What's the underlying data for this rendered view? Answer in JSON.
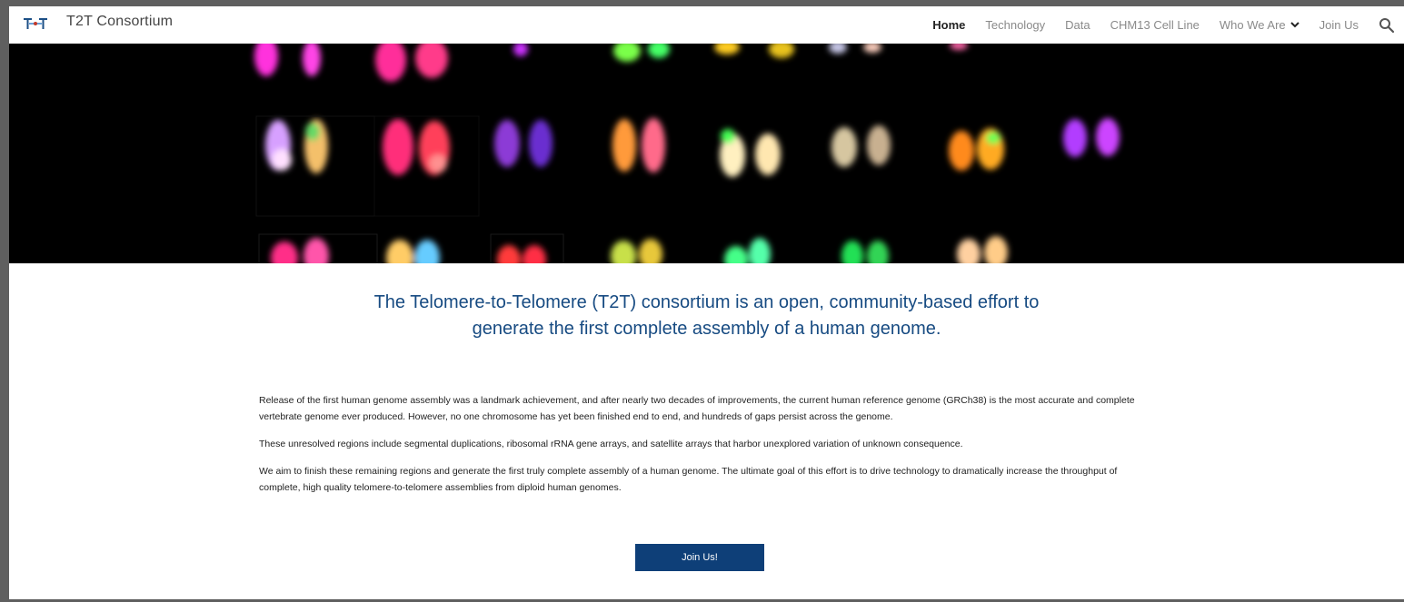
{
  "header": {
    "site_title": "T2T Consortium",
    "logo_icon": "t2t-logo-icon",
    "nav": [
      {
        "label": "Home",
        "active": true
      },
      {
        "label": "Technology",
        "active": false
      },
      {
        "label": "Data",
        "active": false
      },
      {
        "label": "CHM13 Cell Line",
        "active": false
      },
      {
        "label": "Who We Are",
        "active": false,
        "has_dropdown": true
      },
      {
        "label": "Join Us",
        "active": false
      }
    ],
    "search_icon": "search-icon"
  },
  "hero": {
    "image": "chromosome-karyotype-banner"
  },
  "main": {
    "headline_line1": "The Telomere-to-Telomere (T2T) consortium is an open, community-based effort to",
    "headline_line2": "generate the first complete assembly of a human genome.",
    "paragraphs": [
      "Release of the first human genome assembly was a landmark achievement, and after nearly two decades of improvements, the current human reference genome (GRCh38) is the most accurate and complete vertebrate genome ever produced. However, no one chromosome has yet been finished end to end, and hundreds of gaps persist across the genome.",
      "These unresolved regions include segmental duplications, ribosomal rRNA gene arrays, and satellite arrays that harbor unexplored variation of unknown consequence.",
      "We aim to finish these remaining regions and generate the first truly complete assembly of a human genome.  The ultimate goal of this effort is to drive technology to dramatically increase the throughput of complete, high quality telomere-to-telomere assemblies from diploid human genomes."
    ],
    "cta_label": "Join Us!"
  },
  "colors": {
    "headline": "#174b82",
    "cta_background": "#0e3f78",
    "hero_background": "#000000"
  }
}
